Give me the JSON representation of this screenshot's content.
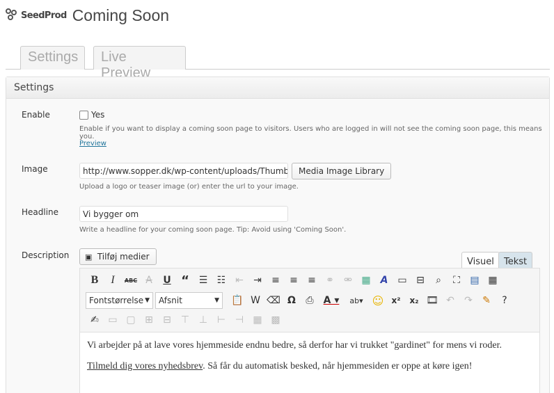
{
  "header": {
    "logo_text": "SeedProd",
    "title": "Coming Soon"
  },
  "tabs": [
    {
      "label": "Settings"
    },
    {
      "label": "Live Preview"
    }
  ],
  "panel": {
    "title": "Settings"
  },
  "enable": {
    "label": "Enable",
    "checkbox_label": "Yes",
    "checked": false,
    "help": "Enable if you want to display a coming soon page to visitors. Users who are logged in will not see the coming soon page, this means you.",
    "preview_link": "Preview"
  },
  "image": {
    "label": "Image",
    "value": "http://www.sopper.dk/wp-content/uploads/Thumbs-up-",
    "button": "Media Image Library",
    "help": "Upload a logo or teaser image (or) enter the url to your image."
  },
  "headline": {
    "label": "Headline",
    "value": "Vi bygger om",
    "help": "Write a headline for your coming soon page. Tip: Avoid using 'Coming Soon'."
  },
  "description": {
    "label": "Description",
    "add_media_button": "Tilføj medier",
    "tab_visual": "Visuel",
    "tab_text": "Tekst",
    "font_size_select": "Fontstørrelse",
    "format_select": "Afsnit",
    "paragraph1": "Vi arbejder på at lave vores hjemmeside endnu bedre, så derfor har vi trukket \"gardinet\" for mens vi roder.",
    "link_text": "Tilmeld dig vores nyhedsbrev",
    "paragraph2_rest": ". Så får du automatisk besked, når hjemmesiden er oppe at køre igen!"
  },
  "toolbar_icons": {
    "row1": [
      "bold-icon",
      "italic-icon",
      "strikethrough-abc-icon",
      "strikethrough-icon",
      "underline-icon",
      "blockquote-icon",
      "bullet-list-icon",
      "numbered-list-icon",
      "outdent-icon",
      "indent-icon",
      "align-left-icon",
      "align-center-icon",
      "align-right-icon",
      "link-icon",
      "unlink-icon",
      "insert-image-icon",
      "spellcheck-icon",
      "horizontal-rule-icon",
      "page-break-icon",
      "find-icon",
      "fullscreen-icon",
      "paste-word-icon",
      "table-icon"
    ],
    "row2": [
      "paste-text-icon",
      "paste-word2-icon",
      "eraser-icon",
      "omega-icon",
      "print-icon",
      "font-color-icon",
      "highlight-icon",
      "emoticon-icon",
      "superscript-icon",
      "subscript-icon",
      "media-icon",
      "undo-icon",
      "redo-icon",
      "edit-image-icon",
      "help-icon"
    ],
    "row3": [
      "source-icon",
      "table-row-icon",
      "table-cell-icon",
      "split-cell-icon",
      "merge-cell-icon",
      "insert-row-icon",
      "delete-row-icon",
      "insert-col-icon",
      "delete-col-icon",
      "table-props-icon",
      "delete-table-icon"
    ]
  }
}
